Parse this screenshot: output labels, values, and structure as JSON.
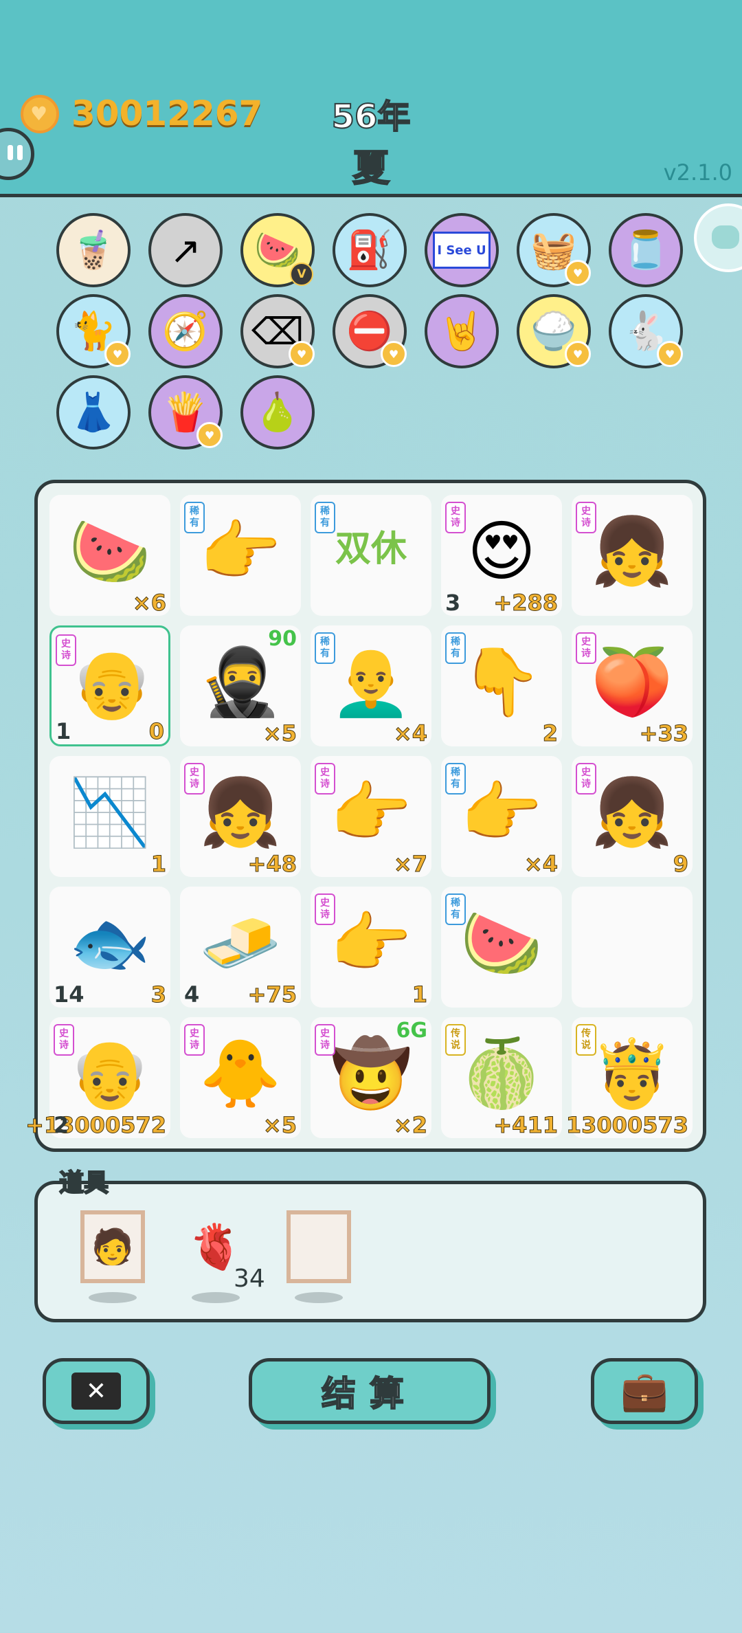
{
  "header": {
    "coins": "30012267",
    "year": "56年",
    "season": "夏",
    "version": "v2.1.0"
  },
  "icons": [
    {
      "icon": "milk-tea-cup",
      "glyph": "🧋",
      "bg": "#f7ecd7",
      "badge": "none"
    },
    {
      "icon": "trend-arrow",
      "glyph": "↗",
      "bg": "#d2d2d2",
      "badge": "none"
    },
    {
      "icon": "fruit-platter",
      "glyph": "🍉",
      "bg": "#fff08a",
      "badge": "v"
    },
    {
      "icon": "air-pump",
      "glyph": "⛽",
      "bg": "#b9e8f7",
      "badge": "none"
    },
    {
      "icon": "i-see-u-sign",
      "glyph": "I See U",
      "bg": "#c9a6e8",
      "badge": "none"
    },
    {
      "icon": "fruit-basket",
      "glyph": "🧺",
      "bg": "#b9e8f7",
      "badge": "heart"
    },
    {
      "icon": "jar",
      "glyph": "🫙",
      "bg": "#c9a6e8",
      "badge": "none"
    },
    {
      "icon": "cat",
      "glyph": "🐈",
      "bg": "#b9e8f7",
      "badge": "heart"
    },
    {
      "icon": "compass",
      "glyph": "🧭",
      "bg": "#c9a6e8",
      "badge": "none"
    },
    {
      "icon": "delete-key",
      "glyph": "⌫",
      "bg": "#d2d2d2",
      "badge": "heart"
    },
    {
      "icon": "no-entry",
      "glyph": "⛔",
      "bg": "#d2d2d2",
      "badge": "heart"
    },
    {
      "icon": "rock-hand",
      "glyph": "🤘",
      "bg": "#c9a6e8",
      "badge": "none"
    },
    {
      "icon": "rice-bowl",
      "glyph": "🍚",
      "bg": "#fff08a",
      "badge": "heart"
    },
    {
      "icon": "rabbit",
      "glyph": "🐇",
      "bg": "#b9e8f7",
      "badge": "heart"
    },
    {
      "icon": "skirt",
      "glyph": "👗",
      "bg": "#b9e8f7",
      "badge": "none"
    },
    {
      "icon": "french-fries",
      "glyph": "🍟",
      "bg": "#c9a6e8",
      "badge": "heart"
    },
    {
      "icon": "pomelo",
      "glyph": "🍐",
      "bg": "#c9a6e8",
      "badge": "none"
    }
  ],
  "board": [
    {
      "icon": "watermelon-slice",
      "glyph": "🍉",
      "tag": "",
      "br": "×6",
      "bl": "",
      "tr": ""
    },
    {
      "icon": "pointing-hand-brown",
      "glyph": "👉",
      "tag": "稀有",
      "br": "",
      "bl": "",
      "tr": ""
    },
    {
      "icon": "double-rest-text",
      "glyph": "",
      "big": "双休",
      "tag": "稀有",
      "br": "",
      "bl": "",
      "tr": ""
    },
    {
      "icon": "old-man-heart-eyes",
      "glyph": "😍",
      "tag": "史诗",
      "br": "+288",
      "bl": "3",
      "tr": ""
    },
    {
      "icon": "braided-girl",
      "glyph": "👧",
      "tag": "史诗",
      "br": "",
      "bl": "",
      "tr": ""
    },
    {
      "icon": "old-man-glasses",
      "glyph": "👴",
      "tag": "史诗",
      "br": "0",
      "bl": "1",
      "tr": "",
      "sel": true
    },
    {
      "icon": "thief",
      "glyph": "🥷",
      "tag": "",
      "br": "×5",
      "bl": "",
      "tr": "90"
    },
    {
      "icon": "bald-man",
      "glyph": "👨‍🦲",
      "tag": "稀有",
      "br": "×4",
      "bl": "",
      "tr": ""
    },
    {
      "icon": "pointing-down-hand",
      "glyph": "👇",
      "tag": "稀有",
      "br": "2",
      "bl": "",
      "tr": ""
    },
    {
      "icon": "peach",
      "glyph": "🍑",
      "tag": "史诗",
      "br": "+33",
      "bl": "",
      "tr": ""
    },
    {
      "icon": "falling-chart",
      "glyph": "📉",
      "tag": "",
      "br": "1",
      "bl": "",
      "tr": ""
    },
    {
      "icon": "braided-girl",
      "glyph": "👧",
      "tag": "史诗",
      "br": "+48",
      "bl": "",
      "tr": ""
    },
    {
      "icon": "pointing-hand-gray",
      "glyph": "👉",
      "tag": "史诗",
      "br": "×7",
      "bl": "",
      "tr": ""
    },
    {
      "icon": "pointing-hand-brown",
      "glyph": "👉",
      "tag": "稀有",
      "br": "×4",
      "bl": "",
      "tr": ""
    },
    {
      "icon": "braided-girl",
      "glyph": "👧",
      "tag": "史诗",
      "br": "9",
      "bl": "",
      "tr": ""
    },
    {
      "icon": "fish",
      "glyph": "🐟",
      "tag": "",
      "br": "3",
      "bl": "14",
      "tr": ""
    },
    {
      "icon": "gold-bars",
      "glyph": "🧈",
      "tag": "",
      "br": "+75",
      "bl": "4",
      "tr": ""
    },
    {
      "icon": "pointing-hand-gray",
      "glyph": "👉",
      "tag": "史诗",
      "br": "1",
      "bl": "",
      "tr": ""
    },
    {
      "icon": "watermelon-slice",
      "glyph": "🍉",
      "tag": "稀有",
      "br": "",
      "bl": "",
      "tr": ""
    },
    {
      "icon": "empty",
      "glyph": "",
      "tag": "",
      "br": "",
      "bl": "",
      "tr": ""
    },
    {
      "icon": "old-man-glasses",
      "glyph": "👴",
      "tag": "史诗",
      "br": "+13000572",
      "bl": "2",
      "tr": ""
    },
    {
      "icon": "chick-with-hair",
      "glyph": "🐥",
      "tag": "史诗",
      "br": "×5",
      "bl": "",
      "tr": ""
    },
    {
      "icon": "farmer-heart-eyes",
      "glyph": "🤠",
      "tag": "史诗",
      "br": "×2",
      "bl": "",
      "tr": "6G"
    },
    {
      "icon": "watermelon",
      "glyph": "🍈",
      "tag": "传说",
      "br": "+411",
      "bl": "",
      "tr": ""
    },
    {
      "icon": "king-old-man",
      "glyph": "🤴",
      "tag": "传说",
      "br": "13000573",
      "bl": "",
      "tr": ""
    }
  ],
  "props": {
    "title": "道具",
    "items": [
      {
        "icon": "portrait-frame",
        "glyph": "🧑"
      },
      {
        "icon": "liver",
        "glyph": "🫀",
        "count": "34"
      },
      {
        "icon": "empty-frame",
        "glyph": ""
      }
    ]
  },
  "buttons": {
    "cancel_icon": "close-key-icon",
    "settle_label": "结算",
    "bag_icon": "briefcase-icon"
  },
  "colors": {
    "header": "#5bc2c5",
    "coin_text": "#f3b22b",
    "season": "#4fd6c4",
    "button": "#6fcfc9",
    "outline": "#2f3b3c"
  }
}
